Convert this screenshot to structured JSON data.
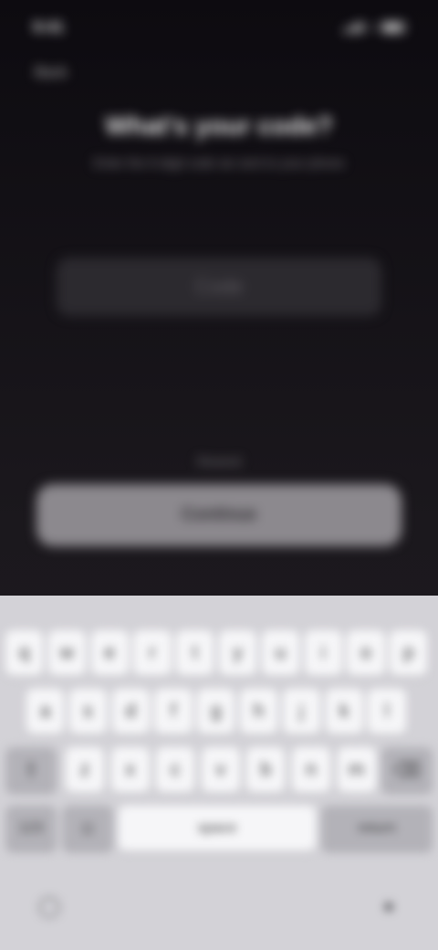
{
  "status_bar": {
    "time": "9:41"
  },
  "nav": {
    "back_label": "Back"
  },
  "page": {
    "title": "What's your code?",
    "subtitle": "Enter the 6-digit code we sent to your phone",
    "code_placeholder": "Code",
    "resend_label": "Resend",
    "continue_label": "Continue"
  },
  "keyboard": {
    "row1": [
      "q",
      "w",
      "e",
      "r",
      "t",
      "y",
      "u",
      "i",
      "o",
      "p"
    ],
    "row2": [
      "a",
      "s",
      "d",
      "f",
      "g",
      "h",
      "j",
      "k",
      "l"
    ],
    "row3": [
      "z",
      "x",
      "c",
      "v",
      "b",
      "n",
      "m"
    ],
    "shift_icon": "shift-arrow-icon",
    "delete_icon": "backspace-icon",
    "numbers_label": "123",
    "emoji_icon": "emoji-icon",
    "space_label": "space",
    "return_label": "return",
    "globe_icon": "globe-icon",
    "mic_icon": "microphone-icon"
  }
}
